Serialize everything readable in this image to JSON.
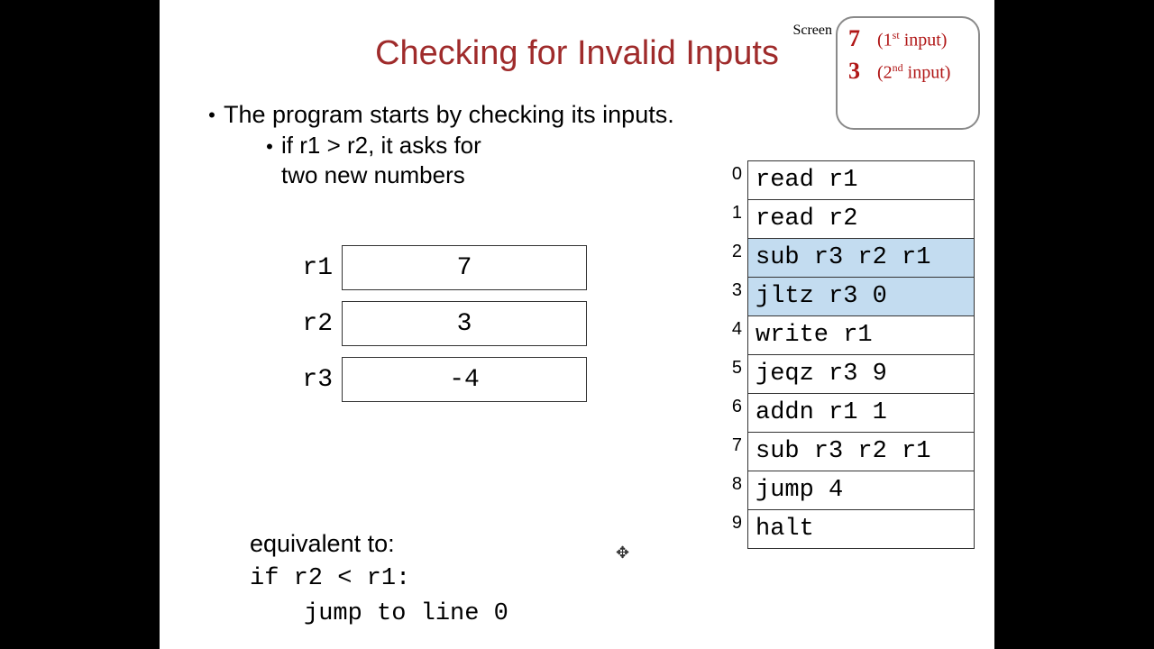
{
  "title": "Checking for Invalid Inputs",
  "bullets": {
    "main": "The program starts by checking its inputs.",
    "sub1": "if r1 > r2, it asks for",
    "sub2": "two new numbers"
  },
  "screen": {
    "label": "Screen",
    "rows": [
      {
        "num": "7",
        "note_pre": "(1",
        "ord": "st",
        "note_post": " input)"
      },
      {
        "num": "3",
        "note_pre": "(2",
        "ord": "nd",
        "note_post": " input)"
      }
    ]
  },
  "registers": [
    {
      "label": "r1",
      "value": "7"
    },
    {
      "label": "r2",
      "value": "3"
    },
    {
      "label": "r3",
      "value": "-4"
    }
  ],
  "code": [
    {
      "n": "0",
      "instr": "read r1",
      "hl": false
    },
    {
      "n": "1",
      "instr": "read r2",
      "hl": false
    },
    {
      "n": "2",
      "instr": "sub r3 r2 r1",
      "hl": true
    },
    {
      "n": "3",
      "instr": "jltz r3 0",
      "hl": true
    },
    {
      "n": "4",
      "instr": "write r1",
      "hl": false
    },
    {
      "n": "5",
      "instr": "jeqz r3 9",
      "hl": false
    },
    {
      "n": "6",
      "instr": "addn r1 1",
      "hl": false
    },
    {
      "n": "7",
      "instr": "sub r3 r2 r1",
      "hl": false
    },
    {
      "n": "8",
      "instr": "jump 4",
      "hl": false
    },
    {
      "n": "9",
      "instr": "halt",
      "hl": false
    }
  ],
  "equiv": {
    "label": "equivalent to:",
    "line1": "if r2 < r1:",
    "line2": "jump to line 0"
  },
  "cursor_glyph": "✥"
}
